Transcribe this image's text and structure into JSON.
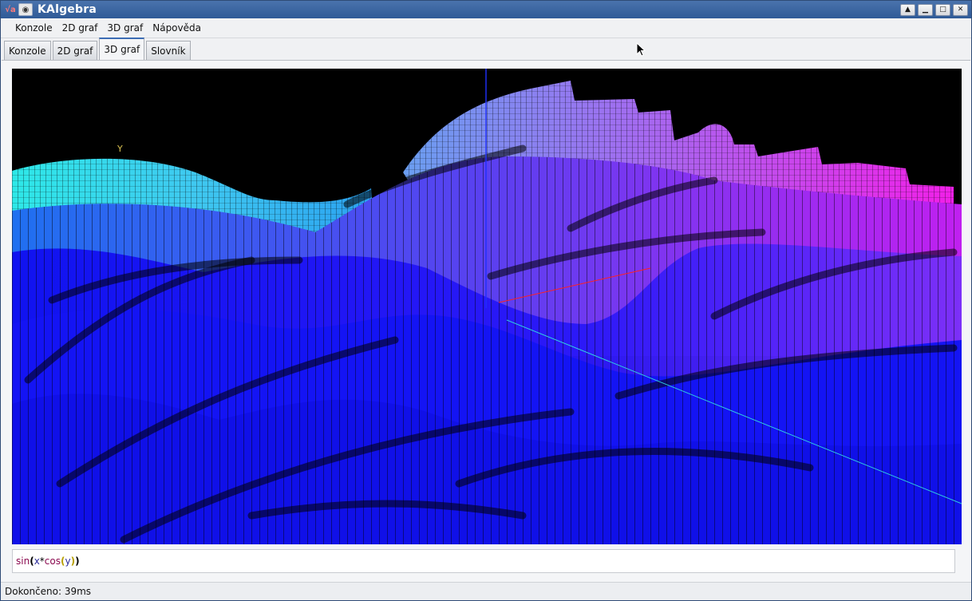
{
  "window": {
    "app_icon": "kalgebra-icon",
    "title": "KAlgebra",
    "buttons": [
      "keep-above-icon",
      "minimize-icon",
      "maximize-icon",
      "close-icon"
    ]
  },
  "menu": {
    "items": [
      {
        "label": "Konzole",
        "mnemonic": "K"
      },
      {
        "label": "2D graf",
        "mnemonic": "2"
      },
      {
        "label": "3D graf",
        "mnemonic": "g"
      },
      {
        "label": "Nápověda",
        "mnemonic": "o"
      }
    ]
  },
  "tabs": [
    {
      "label": "Konzole",
      "active": false
    },
    {
      "label": "2D graf",
      "active": false
    },
    {
      "label": "3D graf",
      "active": true
    },
    {
      "label": "Slovník",
      "active": false
    }
  ],
  "plot": {
    "axis_label_y": "Y",
    "colors": {
      "background": "#000000",
      "surface_low": "#1a1aff",
      "surface_mid": "#6a2bff",
      "surface_high": "#e020e8",
      "surface_cyan": "#2ee8e8"
    }
  },
  "expression": {
    "fn1": "sin",
    "paren_open1": "(",
    "var_x": "x",
    "op": "*",
    "fn2": "cos",
    "paren_open2": "(",
    "var_y": "y",
    "paren_close2": ")",
    "paren_close1": ")"
  },
  "status": {
    "text": "Dokončeno: 39ms"
  }
}
